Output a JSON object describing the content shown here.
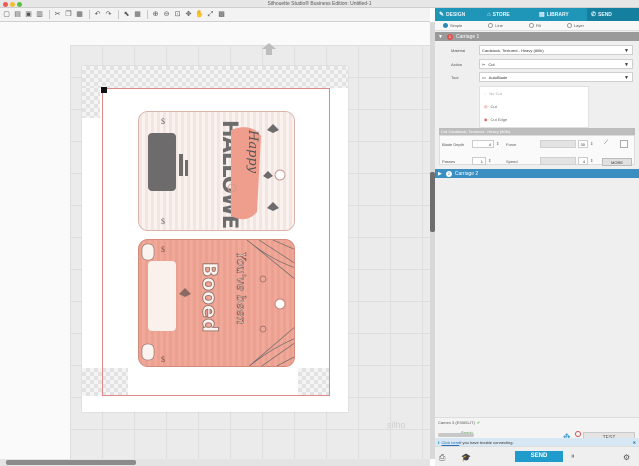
{
  "app": {
    "title": "Silhouette Studio® Business Edition: Untitled-1",
    "watermark": "silho"
  },
  "toolbar": {
    "icons": [
      "new-icon",
      "open-icon",
      "save-icon",
      "print-icon",
      "cut-icon",
      "copy-icon",
      "paste-icon",
      "undo-icon",
      "redo-icon",
      "select-icon",
      "zoom-in-icon",
      "zoom-out-icon",
      "zoom-box-icon",
      "pan-icon",
      "move-icon",
      "fit-icon",
      "grid-icon"
    ]
  },
  "panel": {
    "tabs": [
      {
        "label": "DESIGN",
        "icon": "design-icon"
      },
      {
        "label": "STORE",
        "icon": "store-icon"
      },
      {
        "label": "LIBRARY",
        "icon": "library-icon"
      },
      {
        "label": "SEND",
        "icon": "send-icon",
        "active": true
      }
    ],
    "modes": [
      {
        "label": "Simple",
        "selected": true
      },
      {
        "label": "Line",
        "selected": false
      },
      {
        "label": "Fill",
        "selected": false
      },
      {
        "label": "Layer",
        "selected": false
      }
    ],
    "carriage1": "Carriage 1",
    "carriage2": "Carriage 2",
    "material_label": "Material",
    "material_value": "Cardstock, Textured - Heavy (80lb)",
    "action_label": "Action",
    "action_value": "Cut",
    "tool_label": "Tool",
    "tool_value": "AutoBlade",
    "cut_options": [
      "No Cut",
      "Cut",
      "Cut Edge"
    ],
    "cut_settings_header": "Cut Cardstock, Textured - Heavy (80lb)",
    "blade_depth_label": "Blade Depth",
    "blade_depth_value": "4",
    "passes_label": "Passes",
    "passes_value": "1",
    "force_label": "Force",
    "force_value": "30",
    "speed_label": "Speed",
    "speed_value": "4",
    "more_label": "MORE",
    "device_name": "Cameo 3 (ES0B1JT)",
    "device_status": "Ready",
    "test_label": "TEST",
    "help_link": "Click here",
    "help_text": " if you have trouble connecting.",
    "send_label": "SEND"
  },
  "design": {
    "card1_text": "Happy HALLOWEEN",
    "card2_text": "You've been Booed",
    "colors": {
      "accent": "#1f95b8",
      "card_pink": "#f0a898",
      "card_cream": "#faf2ef",
      "ribbon": "#ef9e8e",
      "dark_grey": "#6d6b6c"
    }
  }
}
